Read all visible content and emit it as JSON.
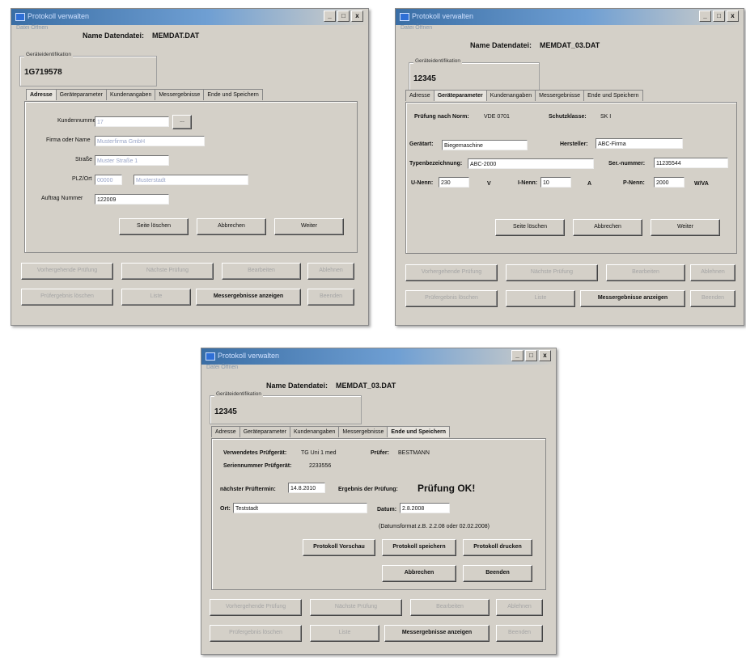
{
  "window_title": "Protokoll verwalten",
  "menu": "Datei Öffnen",
  "window_controls": [
    "_",
    "□",
    "x"
  ],
  "file_label": "Name Datendatei:",
  "tab_labels": [
    "Adresse",
    "Geräteparameter",
    "Kundenangaben",
    "Messergebnisse",
    "Ende und Speichern"
  ],
  "device_id_caption": "Geräteidentifikation",
  "bottom_buttons": {
    "row1": [
      "Vorhergehende Prüfung",
      "Nächste Prüfung",
      "Bearbeiten",
      "Ablehnen"
    ],
    "row2": [
      "Prüfergebnis löschen",
      "Liste",
      "Messergebnisse anzeigen",
      "Beenden"
    ]
  },
  "win1": {
    "file_name": "MEMDAT.DAT",
    "device_id": "1G719578",
    "fields": {
      "customer_no_label": "Kundennummer",
      "customer_no": "17",
      "company_label": "Firma oder Name",
      "company": "Musterfirma GmbH",
      "street_label": "Straße",
      "street": "Muster Straße 1",
      "zip_label": "PLZ/Ort",
      "zip": "00000",
      "city": "Musterstadt",
      "order_label": "Auftrag Nummer",
      "order": "122009"
    },
    "buttons": [
      "Seite löschen",
      "Abbrechen",
      "Weiter"
    ]
  },
  "win2": {
    "file_name": "MEMDAT_03.DAT",
    "device_id": "12345",
    "fields": {
      "standard_label": "Prüfung nach Norm:",
      "standard": "VDE 0701",
      "protection_label": "Schutzklasse:",
      "protection": "SK I",
      "device_label": "Gerätart:",
      "device": "Biegemaschine",
      "manufacturer_label": "Hersteller:",
      "manufacturer": "ABC-Firma",
      "type_label": "Typenbezeichnung:",
      "type": "ABC-2000",
      "serial_label": "Ser.-nummer:",
      "serial": "11235544",
      "voltage_label": "U-Nenn:",
      "voltage": "230",
      "voltage_unit": "V",
      "current_label": "I-Nenn:",
      "current": "10",
      "current_unit": "A",
      "power_label": "P-Nenn:",
      "power": "2000",
      "power_unit": "W/VA"
    },
    "buttons": [
      "Seite löschen",
      "Abbrechen",
      "Weiter"
    ]
  },
  "win3": {
    "file_name": "MEMDAT_03.DAT",
    "device_id": "12345",
    "fields": {
      "tester_label": "Verwendetes Prüfgerät:",
      "tester": "TG Uni 1 med",
      "inspector_label": "Prüfer:",
      "inspector": "BESTMANN",
      "serial_label": "Seriennummer Prüfgerät:",
      "serial": "2233556",
      "next_date_label": "nächster Prüftermin:",
      "next_date": "14.8.2010",
      "result_label": "Ergebnis der Prüfung:",
      "result": "Prüfung OK!",
      "location_label": "Ort:",
      "location": "Teststadt",
      "date_label": "Datum:",
      "date": "2.8.2008",
      "hint": "(Datumsformat z.B. 2.2.08 oder 02.02.2008)"
    },
    "buttons": [
      "Protokoll Vorschau",
      "Protokoll speichern",
      "Protokoll drucken",
      "Abbrechen",
      "Beenden"
    ]
  }
}
